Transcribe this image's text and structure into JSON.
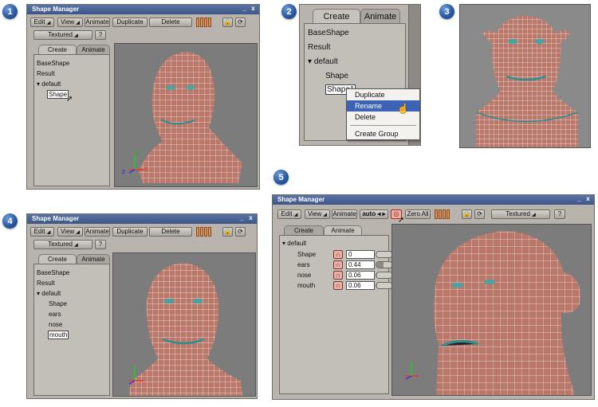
{
  "badges": [
    "1",
    "2",
    "3",
    "4",
    "5"
  ],
  "window_title": "Shape Manager",
  "window_controls": {
    "minimize": "_",
    "close": "x"
  },
  "toolbar": {
    "edit": "Edit",
    "view": "View",
    "animate": "Animate",
    "duplicate": "Duplicate",
    "delete": "Delete",
    "textured": "Textured",
    "help": "?",
    "auto": "auto",
    "zero_all": "Zero All"
  },
  "tabs": {
    "create": "Create",
    "animate": "Animate"
  },
  "panel1": {
    "tree": [
      {
        "label": "BaseShape"
      },
      {
        "label": "Result"
      },
      {
        "label": "default",
        "expanded": true
      },
      {
        "label": "Shape",
        "selected": true
      }
    ]
  },
  "panel2": {
    "tree": [
      {
        "label": "BaseShape"
      },
      {
        "label": "Result"
      },
      {
        "label": "default",
        "expanded": true
      },
      {
        "label": "Shape"
      },
      {
        "label": "Shape1",
        "selected": true
      }
    ],
    "context_menu": [
      "Duplicate",
      "Rename",
      "Delete",
      "Create Group"
    ],
    "highlighted_item": "Rename"
  },
  "panel4": {
    "tree": [
      {
        "label": "BaseShape"
      },
      {
        "label": "Result"
      },
      {
        "label": "default",
        "expanded": true
      },
      {
        "label": "Shape"
      },
      {
        "label": "ears"
      },
      {
        "label": "nose"
      },
      {
        "label": "mouth",
        "selected": true
      }
    ]
  },
  "panel5": {
    "group": "default",
    "sliders": [
      {
        "label": "Shape",
        "value": "0",
        "fraction": 0.0
      },
      {
        "label": "ears",
        "value": "0.44",
        "fraction": 0.44
      },
      {
        "label": "nose",
        "value": "0.06",
        "fraction": 0.06
      },
      {
        "label": "mouth",
        "value": "0.06",
        "fraction": 0.06
      }
    ]
  },
  "axis_labels": {
    "x": "x",
    "y": "y",
    "z": "z"
  },
  "colors": {
    "skin": "#b9786a",
    "wire": "#ffffff",
    "viewport_bg": "#7c7c7c",
    "title_bar": "#4a6296",
    "key_slots": "#e28b4b",
    "menu_highlight": "#3d63b5"
  }
}
